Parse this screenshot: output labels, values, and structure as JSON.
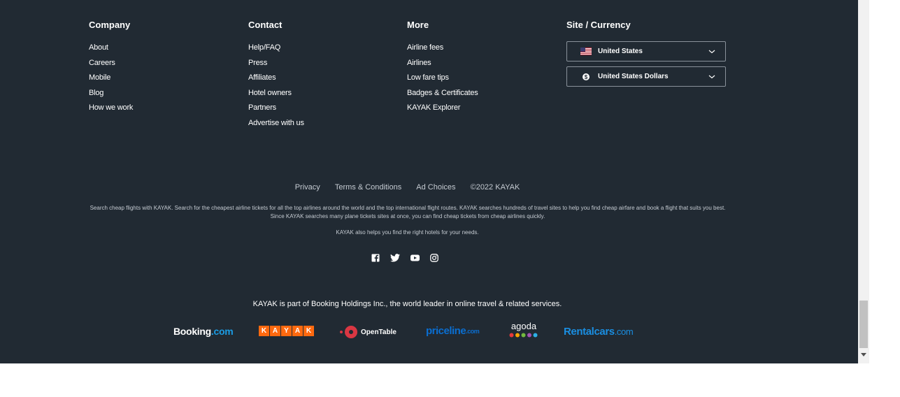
{
  "columns": [
    {
      "heading": "Company",
      "links": [
        "About",
        "Careers",
        "Mobile",
        "Blog",
        "How we work"
      ]
    },
    {
      "heading": "Contact",
      "links": [
        "Help/FAQ",
        "Press",
        "Affiliates",
        "Hotel owners",
        "Partners",
        "Advertise with us"
      ]
    },
    {
      "heading": "More",
      "links": [
        "Airline fees",
        "Airlines",
        "Low fare tips",
        "Badges & Certificates",
        "KAYAK Explorer"
      ]
    },
    {
      "heading": "Site / Currency"
    }
  ],
  "site_select": {
    "value": "United States",
    "icon": "us-flag-icon"
  },
  "currency_select": {
    "value": "United States Dollars",
    "icon": "dollar-icon"
  },
  "legal": {
    "privacy": "Privacy",
    "terms": "Terms & Conditions",
    "ad_choices": "Ad Choices",
    "copyright": "©2022 KAYAK"
  },
  "description": "Search cheap flights with KAYAK. Search for the cheapest airline tickets for all the top airlines around the world and the top international flight routes. KAYAK searches hundreds of travel sites to help you find cheap airfare and book a flight that suits you best. Since KAYAK searches many plane tickets sites at once, you can find cheap tickets from cheap airlines quickly.",
  "description2": "KAYAK also helps you find the right hotels for your needs.",
  "social_icons": [
    "facebook-icon",
    "twitter-icon",
    "youtube-icon",
    "instagram-icon"
  ],
  "holding_text": "KAYAK is part of Booking Holdings Inc., the world leader in online travel & related services.",
  "brands": {
    "booking_a": "Booking",
    "booking_b": ".com",
    "kayak": [
      "K",
      "A",
      "Y",
      "A",
      "K"
    ],
    "opentable": "OpenTable",
    "priceline_a": "priceline",
    "priceline_b": ".com",
    "agoda": "agoda",
    "rentalcars_a": "Rentalcars",
    "rentalcars_b": ".com"
  },
  "colors": {
    "footer_bg": "#212a33",
    "kayak_orange": "#ff690f",
    "booking_blue": "#1b9ce4",
    "priceline_blue": "#0a6ed1",
    "rentalcars_blue": "#1a8ee1"
  }
}
